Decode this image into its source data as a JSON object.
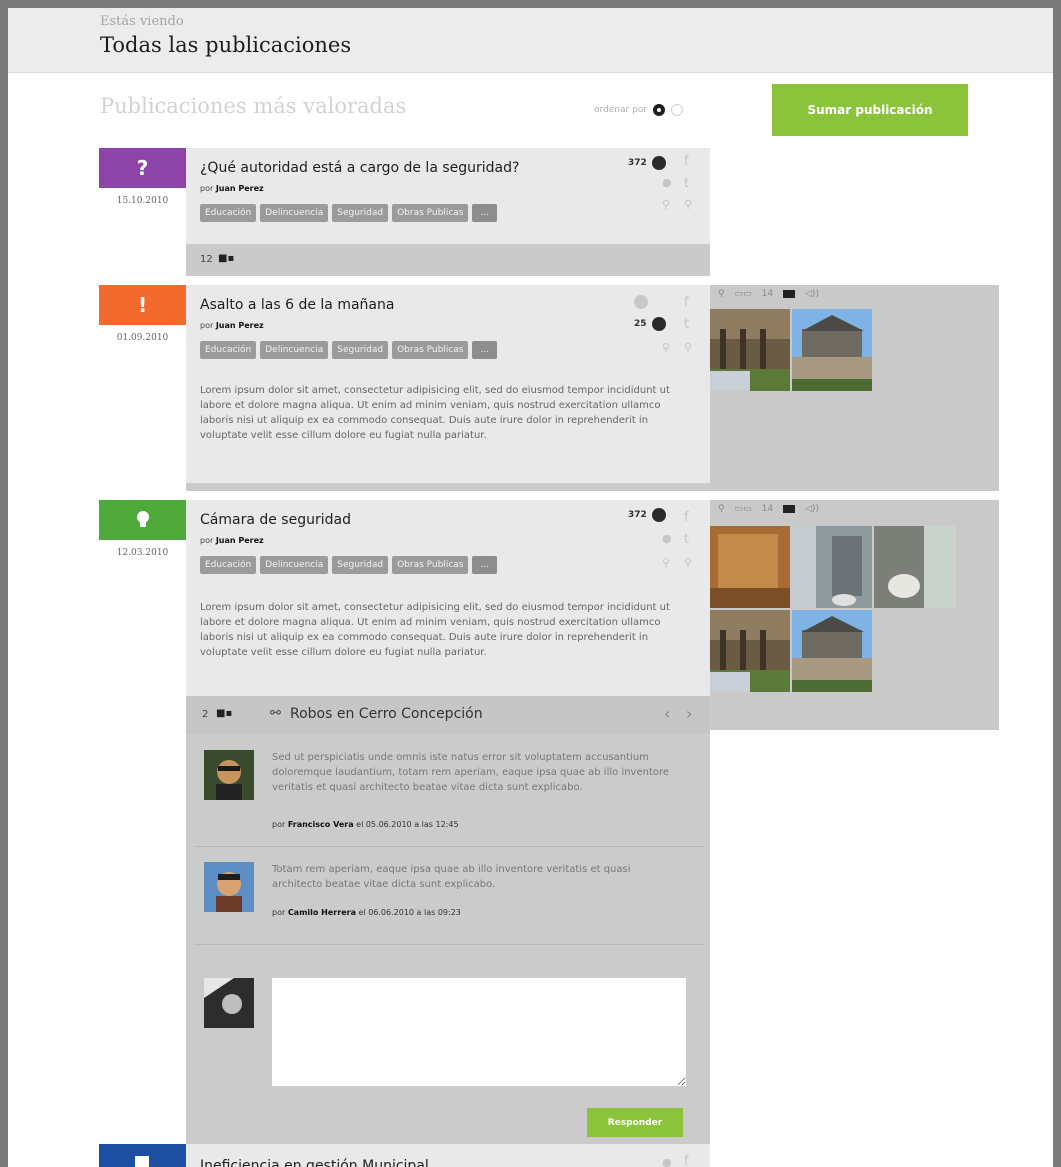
{
  "header": {
    "viewing_label": "Estás viendo",
    "title": "Todas las publicaciones"
  },
  "list": {
    "title": "Publicaciones más valoradas",
    "sort_label": "ordenar por",
    "add_button": "Sumar publicación"
  },
  "colors": {
    "accent_green": "#8bc43b",
    "badge_question": "#8d44a8",
    "badge_alert": "#f26a2c",
    "badge_idea": "#4fa83a",
    "badge_info": "#1d4fa3"
  },
  "posts": [
    {
      "badge_symbol": "?",
      "badge_icon": "question-icon",
      "date": "15.10.2010",
      "title": "¿Qué autoridad está a cargo de la seguridad?",
      "author_prefix": "por",
      "author": "Juan Perez",
      "score": "372",
      "tags": [
        "Educación",
        "Delincuencia",
        "Seguridad",
        "Obras Publicas",
        "..."
      ],
      "comment_count": "12"
    },
    {
      "badge_symbol": "!",
      "badge_icon": "exclamation-icon",
      "date": "01.09.2010",
      "title": "Asalto a las 6 de la mañana",
      "author_prefix": "por",
      "author": "Juan Perez",
      "score": "25",
      "tags": [
        "Educación",
        "Delincuencia",
        "Seguridad",
        "Obras Publicas",
        "..."
      ],
      "body": "Lorem ipsum dolor sit amet, consectetur adipisicing elit, sed do eiusmod tempor incididunt ut labore et dolore magna aliqua. Ut enim ad minim veniam, quis nostrud exercitation ullamco laboris nisi ut aliquip ex ea commodo consequat. Duis aute irure dolor in reprehenderit in voluptate velit esse cillum dolore eu fugiat nulla pariatur.",
      "gallery_count": "14"
    },
    {
      "badge_symbol": "",
      "badge_icon": "lightbulb-icon",
      "date": "12.03.2010",
      "title": "Cámara de seguridad",
      "author_prefix": "por",
      "author": "Juan Perez",
      "score": "372",
      "tags": [
        "Educación",
        "Delincuencia",
        "Seguridad",
        "Obras Publicas",
        "..."
      ],
      "body": "Lorem ipsum dolor sit amet, consectetur adipisicing elit, sed do eiusmod tempor incididunt ut labore et dolore magna aliqua. Ut enim ad minim veniam, quis nostrud exercitation ullamco laboris nisi ut aliquip ex ea commodo consequat. Duis aute irure dolor in reprehenderit in voluptate velit esse cillum dolore eu fugiat nulla pariatur.",
      "gallery_count": "14",
      "comment_count": "2",
      "related_link": "Robos en Cerro Concepción",
      "comments": [
        {
          "text": "Sed ut perspiciatis unde omnis iste natus error sit voluptatem accusantium doloremque laudantium, totam rem aperiam, eaque ipsa quae ab illo inventore veritatis et quasi architecto beatae vitae dicta sunt explicabo.",
          "meta_prefix": "por",
          "author": "Francisco Vera",
          "meta_suffix": "el 05.06.2010 a las 12:45"
        },
        {
          "text": "Totam rem aperiam, eaque ipsa quae ab illo inventore veritatis et quasi architecto beatae vitae dicta sunt explicabo.",
          "meta_prefix": "por",
          "author": "Camilo Herrera",
          "meta_suffix": "el 06.06.2010 a las 09:23"
        }
      ],
      "reply_placeholder": "",
      "reply_button": "Responder"
    },
    {
      "badge_symbol": "",
      "badge_icon": "info-icon",
      "title": "Ineficiencia en gestión Municipal"
    }
  ]
}
